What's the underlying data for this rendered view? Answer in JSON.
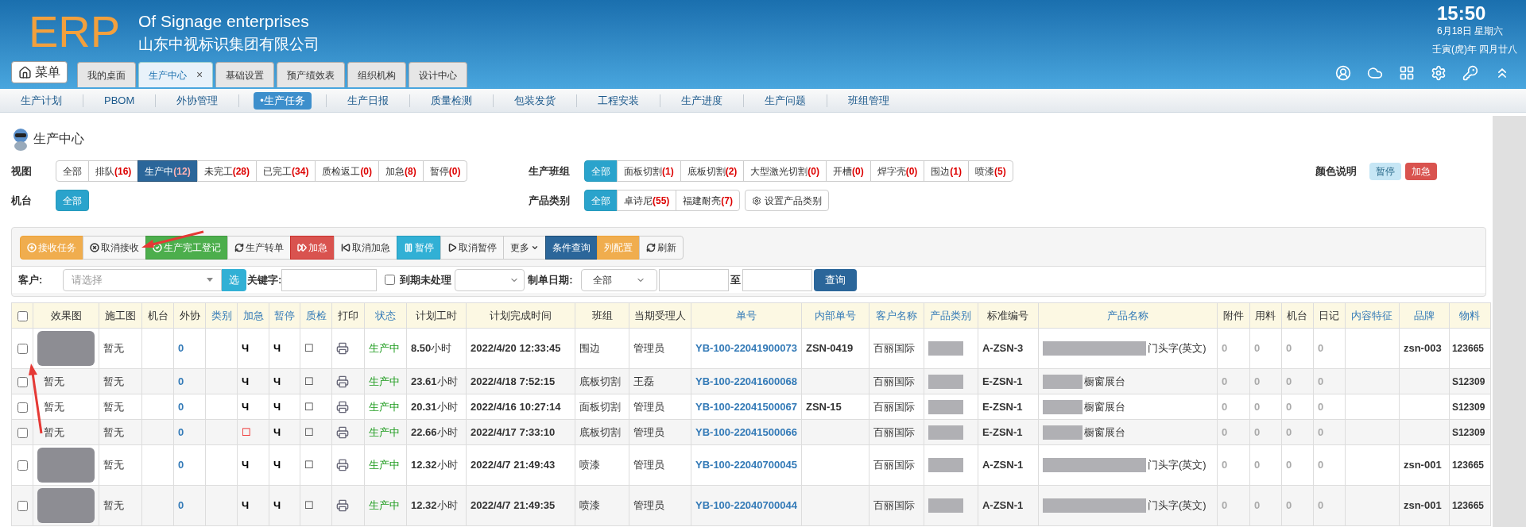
{
  "brand": {
    "logo": "ERP",
    "title": "Of Signage enterprises",
    "company": "山东中视标识集团有限公司"
  },
  "clock": {
    "time": "15:50",
    "date": "6月18日 星期六",
    "lunar": "壬寅(虎)年 四月廿八"
  },
  "menu_button": "菜单",
  "tabs": [
    {
      "label": "我的桌面",
      "selected": false
    },
    {
      "label": "生产中心",
      "selected": true,
      "close": "×"
    },
    {
      "label": "基础设置",
      "selected": false
    },
    {
      "label": "预产绩效表",
      "selected": false
    },
    {
      "label": "组织机构",
      "selected": false
    },
    {
      "label": "设计中心",
      "selected": false
    }
  ],
  "subnav": [
    {
      "label": "生产计划",
      "selected": false
    },
    {
      "label": "PBOM",
      "selected": false
    },
    {
      "label": "外协管理",
      "selected": false
    },
    {
      "label": "•生产任务",
      "selected": true
    },
    {
      "label": "生产日报",
      "selected": false
    },
    {
      "label": "质量检测",
      "selected": false
    },
    {
      "label": "包装发货",
      "selected": false
    },
    {
      "label": "工程安装",
      "selected": false
    },
    {
      "label": "生产进度",
      "selected": false
    },
    {
      "label": "生产问题",
      "selected": false
    },
    {
      "label": "班组管理",
      "selected": false
    }
  ],
  "page_title": "生产中心",
  "filters": {
    "view": {
      "label": "视图",
      "options": [
        {
          "label": "全部",
          "selected": false
        },
        {
          "label": "排队",
          "count": "(16)",
          "selected": false
        },
        {
          "label": "生产中",
          "count": "(12)",
          "selected": true
        },
        {
          "label": "未完工",
          "count": "(28)",
          "selected": false
        },
        {
          "label": "已完工",
          "count": "(34)",
          "selected": false
        },
        {
          "label": "质检返工",
          "count": "(0)",
          "selected": false
        },
        {
          "label": "加急",
          "count": "(8)",
          "selected": false
        },
        {
          "label": "暂停",
          "count": "(0)",
          "selected": false
        }
      ]
    },
    "machine": {
      "label": "机台",
      "options": [
        {
          "label": "全部",
          "selected": true
        }
      ]
    },
    "team": {
      "label": "生产班组",
      "options": [
        {
          "label": "全部",
          "selected": true
        },
        {
          "label": "面板切割",
          "count": "(1)",
          "selected": false
        },
        {
          "label": "底板切割",
          "count": "(2)",
          "selected": false
        },
        {
          "label": "大型激光切割",
          "count": "(0)",
          "selected": false
        },
        {
          "label": "开槽",
          "count": "(0)",
          "selected": false
        },
        {
          "label": "焊字壳",
          "count": "(0)",
          "selected": false
        },
        {
          "label": "围边",
          "count": "(1)",
          "selected": false
        },
        {
          "label": "喷漆",
          "count": "(5)",
          "selected": false
        }
      ]
    },
    "category": {
      "label": "产品类别",
      "options": [
        {
          "label": "全部",
          "selected": true
        },
        {
          "label": "卓诗尼",
          "count": "(55)",
          "selected": false
        },
        {
          "label": "福建耐亮",
          "count": "(7)",
          "selected": false
        }
      ],
      "settings_button": "设置产品类别"
    },
    "legend": {
      "label": "颜色说明",
      "items": [
        {
          "label": "暂停",
          "color": "#c6e6f5"
        },
        {
          "label": "加急",
          "color": "#d9534f"
        }
      ]
    }
  },
  "toolbar": [
    {
      "label": "接收任务",
      "kind": "warning"
    },
    {
      "label": "取消接收",
      "kind": "default"
    },
    {
      "label": "生产完工登记",
      "kind": "success"
    },
    {
      "label": "生产转单",
      "kind": "default"
    },
    {
      "label": "加急",
      "kind": "danger"
    },
    {
      "label": "取消加急",
      "kind": "default"
    },
    {
      "label": "暂停",
      "kind": "info"
    },
    {
      "label": "取消暂停",
      "kind": "default"
    },
    {
      "label": "更多",
      "kind": "default"
    },
    {
      "label": "条件查询",
      "kind": "primary"
    },
    {
      "label": "列配置",
      "kind": "warning"
    },
    {
      "label": "刷新",
      "kind": "default"
    }
  ],
  "search": {
    "customer_label": "客户:",
    "customer_placeholder": "请选择",
    "pick_button": "选",
    "keyword_label": "关键字:",
    "overdue": {
      "label": "到期未处理",
      "checked": false
    },
    "date_label": "制单日期:",
    "date_range": "全部",
    "to_label": "至",
    "query_button": "查询"
  },
  "table": {
    "select_all": {
      "checked": false
    },
    "columns": [
      {
        "label": "效果图",
        "link": false
      },
      {
        "label": "施工图",
        "link": false
      },
      {
        "label": "机台",
        "link": false
      },
      {
        "label": "外协",
        "link": false
      },
      {
        "label": "类别",
        "link": true
      },
      {
        "label": "加急",
        "link": true
      },
      {
        "label": "暂停",
        "link": true
      },
      {
        "label": "质检",
        "link": true
      },
      {
        "label": "打印",
        "link": false
      },
      {
        "label": "状态",
        "link": true
      },
      {
        "label": "计划工时",
        "link": false
      },
      {
        "label": "计划完成时间",
        "link": false
      },
      {
        "label": "班组",
        "link": false
      },
      {
        "label": "当期受理人",
        "link": false
      },
      {
        "label": "单号",
        "link": true
      },
      {
        "label": "内部单号",
        "link": true
      },
      {
        "label": "客户名称",
        "link": true
      },
      {
        "label": "产品类别",
        "link": true
      },
      {
        "label": "标准编号",
        "link": false
      },
      {
        "label": "产品名称",
        "link": true
      },
      {
        "label": "附件",
        "link": false
      },
      {
        "label": "用料",
        "link": false
      },
      {
        "label": "机台",
        "link": false
      },
      {
        "label": "日记",
        "link": false
      },
      {
        "label": "内容特征",
        "link": true
      },
      {
        "label": "品牌",
        "link": true
      },
      {
        "label": "物料",
        "link": true
      }
    ],
    "rows": [
      {
        "checked": false,
        "effect": {
          "kind": "photo"
        },
        "drawing": "暂无",
        "outsource": "0",
        "urgent": {
          "text": "Ч",
          "alert": false
        },
        "pause": "Ч",
        "qc": "☐",
        "status": "生产中",
        "hours": "**8.50**小时",
        "due": "2022/4/20 12:33:45",
        "team": "围边",
        "handler": "管理员",
        "order": "YB-100-22041900073",
        "internal": "ZSN-0419",
        "customer": "百丽国际",
        "standard": "A-ZSN-3",
        "product": "门头字(英文)",
        "attach": "0",
        "material_use": "0",
        "machine": "0",
        "diary": "0",
        "brand": "zsn-003",
        "material": "123665"
      },
      {
        "checked": false,
        "effect": {
          "kind": "text",
          "text": "暂无"
        },
        "drawing": "暂无",
        "outsource": "0",
        "urgent": {
          "text": "Ч",
          "alert": false
        },
        "pause": "Ч",
        "qc": "☐",
        "status": "生产中",
        "hours": "**23.61**小时",
        "due": "2022/4/18 7:52:15",
        "team": "底板切割",
        "handler": "王磊",
        "order": "YB-100-22041600068",
        "customer": "百丽国际",
        "standard": "E-ZSN-1",
        "product": "橱窗展台",
        "attach": "0",
        "material_use": "0",
        "machine": "0",
        "diary": "0",
        "material": "S12309"
      },
      {
        "checked": false,
        "effect": {
          "kind": "text",
          "text": "暂无"
        },
        "drawing": "暂无",
        "outsource": "0",
        "urgent": {
          "text": "Ч",
          "alert": false
        },
        "pause": "Ч",
        "qc": "☐",
        "status": "生产中",
        "hours": "**20.31**小时",
        "due": "2022/4/16 10:27:14",
        "team": "面板切割",
        "handler": "管理员",
        "order": "YB-100-22041500067",
        "internal": "ZSN-15",
        "customer": "百丽国际",
        "standard": "E-ZSN-1",
        "product": "橱窗展台",
        "attach": "0",
        "material_use": "0",
        "machine": "0",
        "diary": "0",
        "material": "S12309"
      },
      {
        "checked": false,
        "effect": {
          "kind": "text",
          "text": "暂无"
        },
        "drawing": "暂无",
        "outsource": "0",
        "urgent": {
          "text": "☐",
          "alert": true
        },
        "pause": "Ч",
        "qc": "☐",
        "status": "生产中",
        "hours": "**22.66**小时",
        "due": "2022/4/17 7:33:10",
        "team": "底板切割",
        "handler": "管理员",
        "order": "YB-100-22041500066",
        "customer": "百丽国际",
        "standard": "E-ZSN-1",
        "product": "橱窗展台",
        "attach": "0",
        "material_use": "0",
        "machine": "0",
        "diary": "0",
        "material": "S12309"
      },
      {
        "checked": false,
        "effect": {
          "kind": "photo"
        },
        "drawing": "暂无",
        "outsource": "0",
        "urgent": {
          "text": "Ч",
          "alert": false
        },
        "pause": "Ч",
        "qc": "☐",
        "status": "生产中",
        "hours": "**12.32**小时",
        "due": "2022/4/7 21:49:43",
        "team": "喷漆",
        "handler": "管理员",
        "order": "YB-100-22040700045",
        "customer": "百丽国际",
        "standard": "A-ZSN-1",
        "product": "门头字(英文)",
        "attach": "0",
        "material_use": "0",
        "machine": "0",
        "diary": "0",
        "brand": "zsn-001",
        "material": "123665"
      },
      {
        "checked": false,
        "effect": {
          "kind": "photo"
        },
        "drawing": "暂无",
        "outsource": "0",
        "urgent": {
          "text": "Ч",
          "alert": false
        },
        "pause": "Ч",
        "qc": "☐",
        "status": "生产中",
        "hours": "**12.32**小时",
        "due": "2022/4/7 21:49:35",
        "team": "喷漆",
        "handler": "管理员",
        "order": "YB-100-22040700044",
        "customer": "百丽国际",
        "standard": "A-ZSN-1",
        "product": "门头字(英文)",
        "attach": "0",
        "material_use": "0",
        "machine": "0",
        "diary": "0",
        "brand": "zsn-001",
        "material": "123665"
      }
    ]
  }
}
